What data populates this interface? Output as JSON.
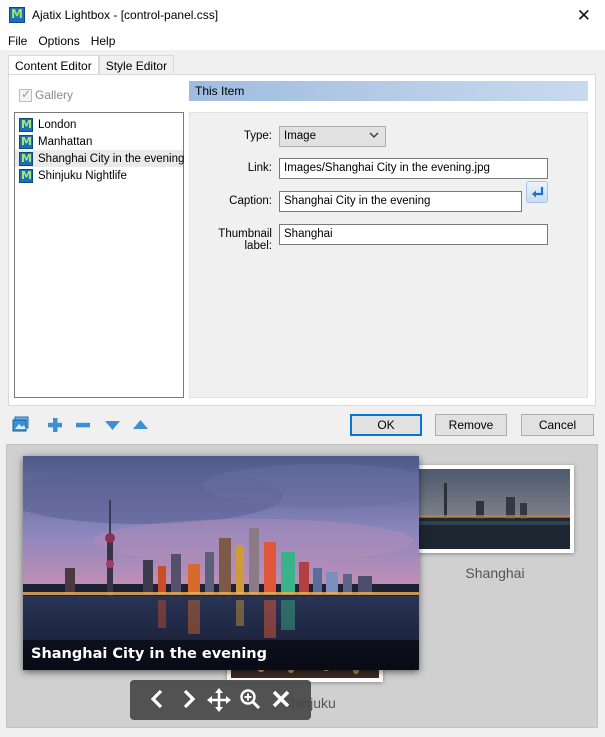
{
  "window": {
    "title": "Ajatix Lightbox - [control-panel.css]"
  },
  "menu": [
    "File",
    "Options",
    "Help"
  ],
  "tabs": [
    "Content Editor",
    "Style Editor"
  ],
  "gallery": {
    "label": "Gallery",
    "checked": true
  },
  "items": [
    "London",
    "Manhattan",
    "Shanghai City in the evening",
    "Shinjuku Nightlife"
  ],
  "selected_item": "Shanghai City in the evening",
  "section": {
    "title": "This Item"
  },
  "props": {
    "type_label": "Type:",
    "type_value": "Image",
    "link_label": "Link:",
    "link_value": "Images/Shanghai City in the evening.jpg",
    "caption_label": "Caption:",
    "caption_value": "Shanghai City in the evening",
    "thumb_label": "Thumbnail label:",
    "thumb_value": "Shanghai"
  },
  "buttons": {
    "ok": "OK",
    "remove": "Remove",
    "cancel": "Cancel"
  },
  "toolbar_icons": [
    "gallery-icon",
    "plus-icon",
    "minus-icon",
    "arrow-down-icon",
    "arrow-up-icon"
  ],
  "preview": {
    "main_caption": "Shanghai City in the evening",
    "thumb_right_label": "Shanghai",
    "thumb_back_label": "Shinjuku"
  },
  "viewer_icons": [
    "chevron-left-icon",
    "chevron-right-icon",
    "move-icon",
    "zoom-in-icon",
    "close-icon"
  ],
  "colors": {
    "accent": "#0078d7",
    "section_header": "#9fbcdf",
    "item_icon": "#1f6fb4"
  }
}
